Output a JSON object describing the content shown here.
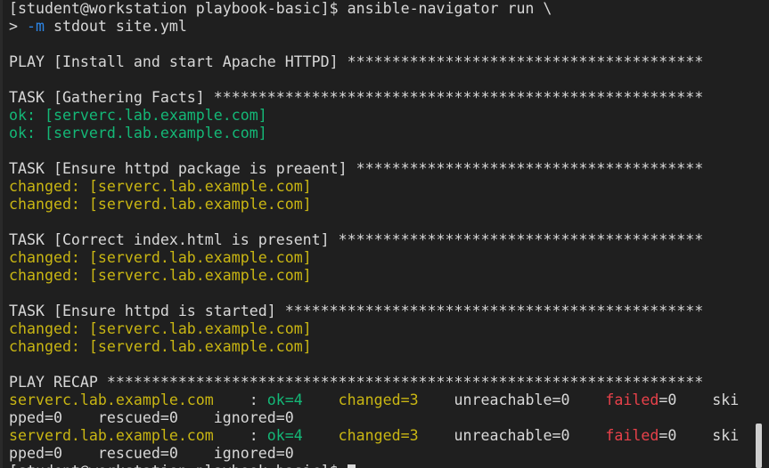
{
  "colors": {
    "background": "#1f1f1f",
    "default": "#d8d8d8",
    "green": "#14b877",
    "yellow": "#c9b613",
    "red": "#e8414a",
    "blue": "#2d86e8"
  },
  "terminal": {
    "lines": [
      [
        {
          "t": "[student@workstation playbook-basic]$ ansible-navigator run \\",
          "c": "default"
        }
      ],
      [
        {
          "t": "> ",
          "c": "default"
        },
        {
          "t": "-m",
          "c": "blue"
        },
        {
          "t": " stdout site.yml",
          "c": "default"
        }
      ],
      [],
      [
        {
          "t": "PLAY [Install and start Apache HTTPD] ****************************************",
          "c": "default"
        }
      ],
      [],
      [
        {
          "t": "TASK [Gathering Facts] *******************************************************",
          "c": "default"
        }
      ],
      [
        {
          "t": "ok: [serverc.lab.example.com]",
          "c": "green"
        }
      ],
      [
        {
          "t": "ok: [serverd.lab.example.com]",
          "c": "green"
        }
      ],
      [],
      [
        {
          "t": "TASK [Ensure httpd package is preaent] ***************************************",
          "c": "default"
        }
      ],
      [
        {
          "t": "changed: [serverc.lab.example.com]",
          "c": "yellow"
        }
      ],
      [
        {
          "t": "changed: [serverd.lab.example.com]",
          "c": "yellow"
        }
      ],
      [],
      [
        {
          "t": "TASK [Correct index.html is present] *****************************************",
          "c": "default"
        }
      ],
      [
        {
          "t": "changed: [serverd.lab.example.com]",
          "c": "yellow"
        }
      ],
      [
        {
          "t": "changed: [serverc.lab.example.com]",
          "c": "yellow"
        }
      ],
      [],
      [
        {
          "t": "TASK [Ensure httpd is started] ***********************************************",
          "c": "default"
        }
      ],
      [
        {
          "t": "changed: [serverc.lab.example.com]",
          "c": "yellow"
        }
      ],
      [
        {
          "t": "changed: [serverd.lab.example.com]",
          "c": "yellow"
        }
      ],
      [],
      [
        {
          "t": "PLAY RECAP *******************************************************************",
          "c": "default"
        }
      ],
      [
        {
          "t": "serverc.lab.example.com",
          "c": "yellow"
        },
        {
          "t": "    : ",
          "c": "default"
        },
        {
          "t": "ok=4",
          "c": "green"
        },
        {
          "t": "    ",
          "c": "default"
        },
        {
          "t": "changed=3",
          "c": "yellow"
        },
        {
          "t": "    unreachable=0    ",
          "c": "default"
        },
        {
          "t": "failed",
          "c": "red"
        },
        {
          "t": "=0    ski",
          "c": "default"
        }
      ],
      [
        {
          "t": "pped=0    rescued=0    ignored=0",
          "c": "default"
        }
      ],
      [
        {
          "t": "serverd.lab.example.com",
          "c": "yellow"
        },
        {
          "t": "    : ",
          "c": "default"
        },
        {
          "t": "ok=4",
          "c": "green"
        },
        {
          "t": "    ",
          "c": "default"
        },
        {
          "t": "changed=3",
          "c": "yellow"
        },
        {
          "t": "    unreachable=0    ",
          "c": "default"
        },
        {
          "t": "failed",
          "c": "red"
        },
        {
          "t": "=0    ski",
          "c": "default"
        }
      ],
      [
        {
          "t": "pped=0    rescued=0    ignored=0",
          "c": "default"
        }
      ],
      [
        {
          "t": "[student@workstation playbook-basic]$ ",
          "c": "default"
        },
        {
          "cursor": true
        }
      ]
    ]
  }
}
